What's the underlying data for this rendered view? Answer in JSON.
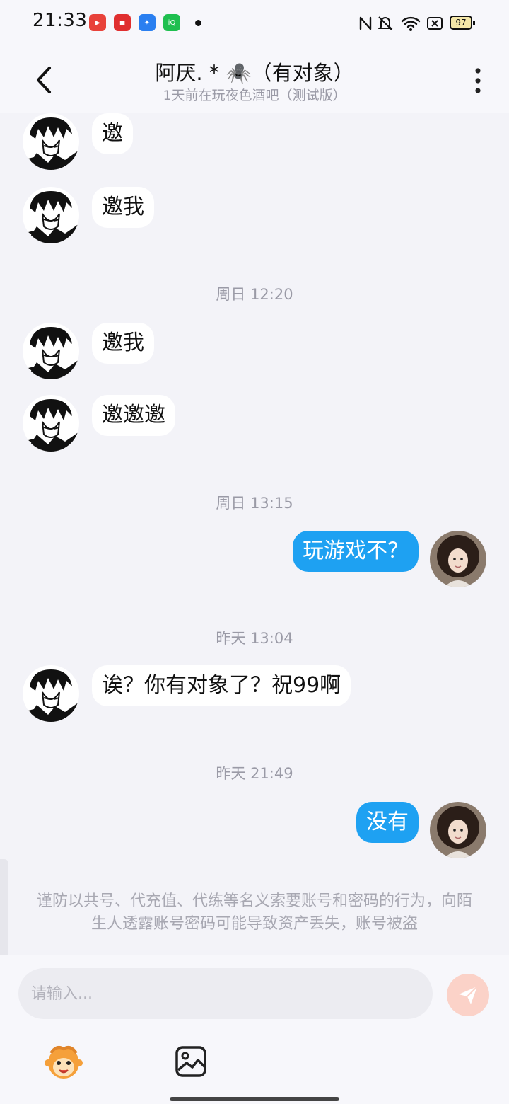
{
  "status_bar": {
    "time": "21:33",
    "battery": "97"
  },
  "header": {
    "title": "阿厌. * 🕷️（有对象）",
    "subtitle": "1天前在玩夜色酒吧（测试版）"
  },
  "messages": [
    {
      "side": "in",
      "text": "邀"
    },
    {
      "side": "in",
      "text": "邀我"
    },
    {
      "timestamp": "周日 12:20"
    },
    {
      "side": "in",
      "text": "邀我"
    },
    {
      "side": "in",
      "text": "邀邀邀"
    },
    {
      "timestamp": "周日 13:15"
    },
    {
      "side": "out",
      "text": "玩游戏不？"
    },
    {
      "timestamp": "昨天 13:04"
    },
    {
      "side": "in",
      "text": "诶？你有对象了？祝99啊"
    },
    {
      "timestamp": "昨天 21:49"
    },
    {
      "side": "out",
      "text": "没有"
    }
  ],
  "warning": "谨防以共号、代充值、代练等名义索要账号和密码的行为，向陌生人透露账号密码可能导致资产丢失，账号被盗",
  "input": {
    "placeholder": "请输入..."
  },
  "colors": {
    "outgoing_bubble": "#1ea1f2",
    "incoming_bubble": "#ffffff",
    "send_button": "#fbd2c8"
  }
}
